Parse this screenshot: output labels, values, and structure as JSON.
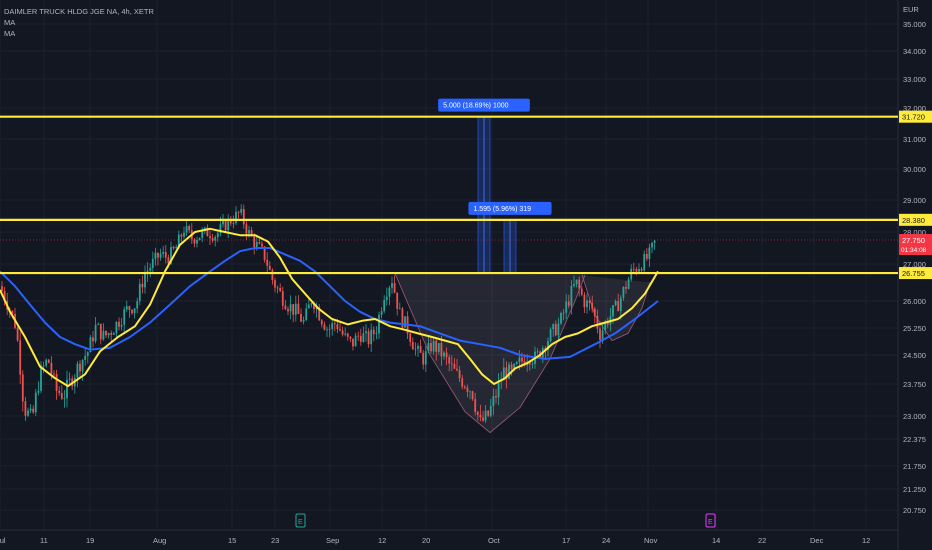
{
  "header": {
    "symbol": "DAIMLER TRUCK HLDG JGE NA, 4h, XETR",
    "indicators": [
      "MA",
      "MA"
    ]
  },
  "chart_data": {
    "type": "candlestick",
    "currency": "EUR",
    "y_ticks": [
      20.75,
      21.25,
      21.75,
      22.375,
      23.0,
      23.75,
      24.5,
      25.25,
      26.0,
      27.0,
      28.0,
      29.0,
      30.0,
      31.0,
      32.0,
      33.0,
      34.0,
      35.0
    ],
    "y_tick_labels": [
      "20.750",
      "21.250",
      "21.750",
      "22.375",
      "23.000",
      "23.750",
      "24.500",
      "25.250",
      "26.000",
      "27.000",
      "28.000",
      "29.000",
      "30.000",
      "31.000",
      "32.000",
      "33.000",
      "34.000",
      "35.000"
    ],
    "x_ticks": [
      {
        "label": "Jul",
        "t": 0
      },
      {
        "label": "11",
        "t": 44
      },
      {
        "label": "19",
        "t": 90
      },
      {
        "label": "Aug",
        "t": 157
      },
      {
        "label": "15",
        "t": 232
      },
      {
        "label": "23",
        "t": 275
      },
      {
        "label": "Sep",
        "t": 330
      },
      {
        "label": "12",
        "t": 382
      },
      {
        "label": "20",
        "t": 426
      },
      {
        "label": "Oct",
        "t": 492
      },
      {
        "label": "17",
        "t": 566
      },
      {
        "label": "24",
        "t": 606
      },
      {
        "label": "Nov",
        "t": 648
      },
      {
        "label": "14",
        "t": 716
      },
      {
        "label": "22",
        "t": 762
      },
      {
        "label": "Dec",
        "t": 814
      },
      {
        "label": "12",
        "t": 866
      }
    ],
    "x_range": [
      0,
      932
    ],
    "horizontal_levels": [
      {
        "value": 31.72,
        "label": "31.720",
        "color": "#ffeb3b"
      },
      {
        "value": 28.38,
        "label": "28.380",
        "color": "#ffeb3b"
      },
      {
        "value": 26.755,
        "label": "26.755",
        "color": "#ffeb3b"
      }
    ],
    "last_price": {
      "value": 27.75,
      "label": "27.750",
      "countdown": "01:34:08",
      "color": "#f23645"
    },
    "measurements": [
      {
        "label": "5.000 (18.69%) 1000",
        "from": 26.755,
        "to": 31.72,
        "t": 484
      },
      {
        "label": "1.595 (5.96%) 319",
        "from": 26.755,
        "to": 28.38,
        "t": 510
      }
    ],
    "events": [
      {
        "label": "E",
        "t": 300,
        "color": "#26a69a"
      },
      {
        "label": "E",
        "t": 710,
        "color": "#e040fb"
      }
    ],
    "ma_fast": [
      [
        0,
        26.3
      ],
      [
        10,
        25.7
      ],
      [
        25,
        25.0
      ],
      [
        40,
        24.2
      ],
      [
        55,
        23.9
      ],
      [
        68,
        23.7
      ],
      [
        85,
        24.0
      ],
      [
        100,
        24.6
      ],
      [
        118,
        25.0
      ],
      [
        135,
        25.3
      ],
      [
        150,
        25.9
      ],
      [
        165,
        26.8
      ],
      [
        180,
        27.6
      ],
      [
        195,
        28.0
      ],
      [
        210,
        28.1
      ],
      [
        225,
        28.0
      ],
      [
        240,
        27.9
      ],
      [
        255,
        27.9
      ],
      [
        268,
        27.7
      ],
      [
        280,
        27.2
      ],
      [
        292,
        26.6
      ],
      [
        305,
        26.2
      ],
      [
        318,
        25.8
      ],
      [
        332,
        25.5
      ],
      [
        348,
        25.35
      ],
      [
        362,
        25.45
      ],
      [
        375,
        25.5
      ],
      [
        390,
        25.3
      ],
      [
        405,
        25.2
      ],
      [
        418,
        25.1
      ],
      [
        432,
        25.0
      ],
      [
        445,
        24.9
      ],
      [
        458,
        24.8
      ],
      [
        470,
        24.4
      ],
      [
        482,
        24.0
      ],
      [
        494,
        23.75
      ],
      [
        505,
        23.9
      ],
      [
        515,
        24.15
      ],
      [
        528,
        24.3
      ],
      [
        540,
        24.5
      ],
      [
        552,
        24.8
      ],
      [
        565,
        25.0
      ],
      [
        578,
        25.1
      ],
      [
        592,
        25.3
      ],
      [
        605,
        25.4
      ],
      [
        618,
        25.5
      ],
      [
        632,
        25.8
      ],
      [
        645,
        26.2
      ],
      [
        658,
        26.8
      ]
    ],
    "ma_slow": [
      [
        0,
        26.8
      ],
      [
        15,
        26.4
      ],
      [
        30,
        25.9
      ],
      [
        45,
        25.4
      ],
      [
        60,
        25.0
      ],
      [
        75,
        24.8
      ],
      [
        90,
        24.65
      ],
      [
        110,
        24.7
      ],
      [
        130,
        25.0
      ],
      [
        150,
        25.4
      ],
      [
        170,
        25.9
      ],
      [
        190,
        26.4
      ],
      [
        210,
        26.8
      ],
      [
        225,
        27.1
      ],
      [
        240,
        27.4
      ],
      [
        255,
        27.5
      ],
      [
        270,
        27.5
      ],
      [
        285,
        27.3
      ],
      [
        300,
        27.1
      ],
      [
        315,
        26.8
      ],
      [
        330,
        26.4
      ],
      [
        345,
        26.0
      ],
      [
        360,
        25.7
      ],
      [
        375,
        25.5
      ],
      [
        390,
        25.4
      ],
      [
        405,
        25.35
      ],
      [
        420,
        25.3
      ],
      [
        440,
        25.1
      ],
      [
        460,
        24.9
      ],
      [
        480,
        24.8
      ],
      [
        500,
        24.7
      ],
      [
        520,
        24.5
      ],
      [
        545,
        24.4
      ],
      [
        570,
        24.45
      ],
      [
        595,
        24.8
      ],
      [
        615,
        25.1
      ],
      [
        635,
        25.5
      ],
      [
        658,
        26.0
      ]
    ],
    "candle_path": [
      [
        0,
        26.4
      ],
      [
        8,
        25.9
      ],
      [
        16,
        25.3
      ],
      [
        24,
        23.2
      ],
      [
        32,
        22.9
      ],
      [
        40,
        24.0
      ],
      [
        48,
        24.4
      ],
      [
        56,
        23.6
      ],
      [
        64,
        23.5
      ],
      [
        72,
        23.9
      ],
      [
        80,
        24.3
      ],
      [
        88,
        24.6
      ],
      [
        96,
        25.3
      ],
      [
        104,
        25.0
      ],
      [
        112,
        25.2
      ],
      [
        120,
        25.5
      ],
      [
        128,
        25.8
      ],
      [
        136,
        25.9
      ],
      [
        144,
        26.7
      ],
      [
        152,
        27.0
      ],
      [
        160,
        27.3
      ],
      [
        168,
        27.2
      ],
      [
        176,
        27.5
      ],
      [
        184,
        28.1
      ],
      [
        192,
        27.8
      ],
      [
        200,
        27.9
      ],
      [
        208,
        28.0
      ],
      [
        216,
        27.9
      ],
      [
        224,
        28.2
      ],
      [
        232,
        28.4
      ],
      [
        240,
        28.6
      ],
      [
        248,
        28.0
      ],
      [
        256,
        27.6
      ],
      [
        264,
        27.3
      ],
      [
        272,
        26.6
      ],
      [
        280,
        26.2
      ],
      [
        288,
        25.9
      ],
      [
        296,
        25.7
      ],
      [
        304,
        25.4
      ],
      [
        312,
        26.1
      ],
      [
        320,
        25.6
      ],
      [
        328,
        25.2
      ],
      [
        336,
        25.4
      ],
      [
        344,
        25.0
      ],
      [
        352,
        24.8
      ],
      [
        360,
        25.1
      ],
      [
        368,
        24.9
      ],
      [
        376,
        25.2
      ],
      [
        384,
        26.2
      ],
      [
        392,
        26.6
      ],
      [
        400,
        25.6
      ],
      [
        408,
        25.2
      ],
      [
        416,
        24.6
      ],
      [
        424,
        24.4
      ],
      [
        432,
        24.8
      ],
      [
        440,
        24.6
      ],
      [
        448,
        24.3
      ],
      [
        456,
        24.0
      ],
      [
        464,
        23.8
      ],
      [
        472,
        23.6
      ],
      [
        480,
        22.8
      ],
      [
        488,
        23.0
      ],
      [
        496,
        23.5
      ],
      [
        504,
        24.1
      ],
      [
        512,
        24.0
      ],
      [
        520,
        24.3
      ],
      [
        528,
        24.5
      ],
      [
        536,
        24.4
      ],
      [
        544,
        24.8
      ],
      [
        552,
        25.1
      ],
      [
        560,
        25.4
      ],
      [
        568,
        26.0
      ],
      [
        576,
        26.5
      ],
      [
        584,
        26.0
      ],
      [
        592,
        25.8
      ],
      [
        600,
        25.1
      ],
      [
        608,
        25.5
      ],
      [
        616,
        25.8
      ],
      [
        624,
        26.3
      ],
      [
        632,
        26.8
      ],
      [
        640,
        27.0
      ],
      [
        648,
        27.2
      ],
      [
        656,
        27.75
      ]
    ],
    "cup_patterns": [
      {
        "points": [
          [
            395,
            26.75
          ],
          [
            430,
            24.5
          ],
          [
            465,
            23.1
          ],
          [
            490,
            22.55
          ],
          [
            520,
            23.2
          ],
          [
            550,
            24.4
          ],
          [
            575,
            26.0
          ],
          [
            585,
            26.7
          ]
        ]
      },
      {
        "points": [
          [
            582,
            26.7
          ],
          [
            595,
            25.6
          ],
          [
            612,
            24.9
          ],
          [
            628,
            25.1
          ],
          [
            642,
            25.8
          ],
          [
            650,
            26.5
          ]
        ]
      }
    ]
  }
}
